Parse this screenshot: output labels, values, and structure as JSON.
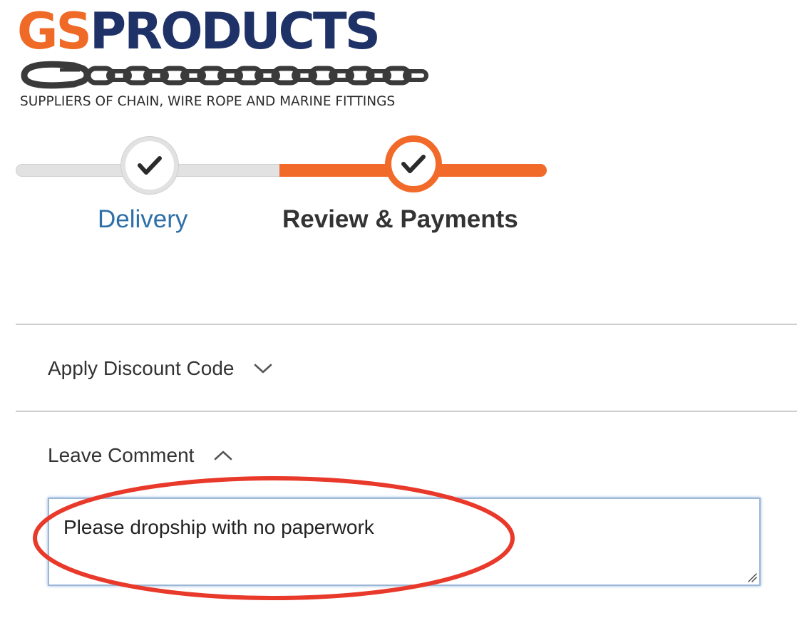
{
  "logo": {
    "brand_prefix": "GS",
    "brand_suffix": "PRODUCTS",
    "tagline": "SUPPLIERS OF CHAIN, WIRE ROPE AND MARINE FITTINGS",
    "colors": {
      "prefix": "#ef6a26",
      "suffix": "#1f3267",
      "chain": "#3a3a3a"
    }
  },
  "progress": {
    "steps": [
      {
        "label": "Delivery",
        "state": "completed",
        "icon": "checkmark-icon"
      },
      {
        "label": "Review & Payments",
        "state": "active",
        "icon": "checkmark-icon"
      }
    ],
    "colors": {
      "active": "#f26a2a",
      "inactive": "#e2e2e2",
      "link": "#2e6fa8"
    }
  },
  "discount": {
    "title": "Apply Discount Code",
    "icon": "chevron-down-icon",
    "expanded": false
  },
  "comment": {
    "title": "Leave Comment",
    "icon": "chevron-up-icon",
    "expanded": true,
    "value": "Please dropship with no paperwork"
  },
  "annotation": {
    "shape": "ellipse",
    "color": "#e8392a"
  }
}
